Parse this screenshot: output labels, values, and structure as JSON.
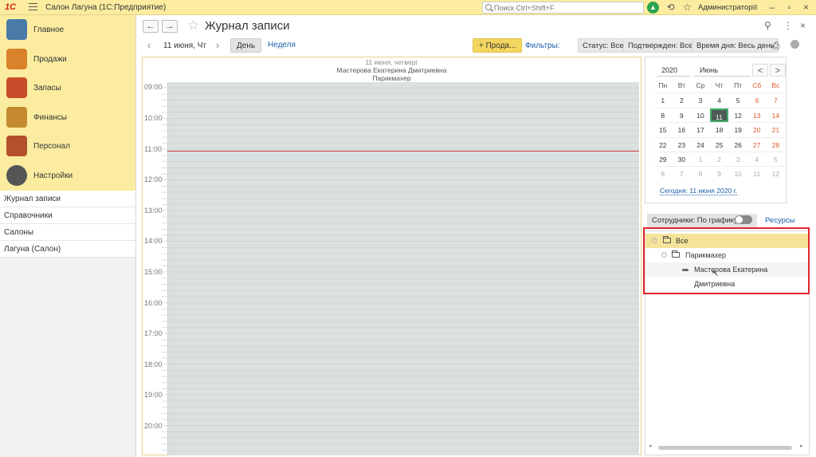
{
  "titlebar": {
    "logo": "1С",
    "app_title": "Салон Лагуна (1С:Предприятие)",
    "search_placeholder": "Поиск Ctrl+Shift+F",
    "user": "Администратор"
  },
  "sections": [
    {
      "label": "Главное",
      "color": "#4a7aa8"
    },
    {
      "label": "Продажи",
      "color": "#d9822b"
    },
    {
      "label": "Запасы",
      "color": "#c94c2a"
    },
    {
      "label": "Финансы",
      "color": "#c58a2e"
    },
    {
      "label": "Персонал",
      "color": "#b4512d"
    },
    {
      "label": "Настройки",
      "color": "#555555"
    }
  ],
  "nav_items": [
    "Журнал записи",
    "Справочники",
    "Салоны",
    "Лагуна (Салон)"
  ],
  "page": {
    "title": "Журнал записи",
    "date": "11 июня, Чт",
    "day_button": "День",
    "week_button": "Неделя",
    "sale_button": "+ Прода...",
    "filters_label": "Фильтры:",
    "chips": [
      "Статус: Все",
      "Подтвержден: Все",
      "Время дня: Весь день"
    ]
  },
  "daygrid": {
    "header_date": "11 июня, четверг",
    "employee": "Мастерова Екатерина Дмитриевна",
    "position": "Парикмахер",
    "hours": [
      "09:00",
      "10:00",
      "11:00",
      "12:00",
      "13:00",
      "14:00",
      "15:00",
      "16:00",
      "17:00",
      "18:00",
      "19:00",
      "20:00"
    ]
  },
  "minical": {
    "year": "2020",
    "month": "Июнь",
    "prev": "<",
    "next": ">",
    "weekdays": [
      "Пн",
      "Вт",
      "Ср",
      "Чт",
      "Пт",
      "Сб",
      "Вс"
    ],
    "weeks": [
      [
        "1",
        "2",
        "3",
        "4",
        "5",
        "6",
        "7"
      ],
      [
        "8",
        "9",
        "10",
        "11",
        "12",
        "13",
        "14"
      ],
      [
        "15",
        "16",
        "17",
        "18",
        "19",
        "20",
        "21"
      ],
      [
        "22",
        "23",
        "24",
        "25",
        "26",
        "27",
        "28"
      ],
      [
        "29",
        "30",
        "1",
        "2",
        "3",
        "4",
        "5"
      ],
      [
        "6",
        "7",
        "8",
        "9",
        "10",
        "11",
        "12"
      ]
    ],
    "selected": "11",
    "today_link": "Сегодня: 11 июня 2020 г."
  },
  "employees": {
    "tab_label": "Сотрудники: По графику",
    "resources_label": "Ресурсы",
    "tree": [
      {
        "label": "Все",
        "level": 0
      },
      {
        "label": "Парикмахер",
        "level": 1
      },
      {
        "label": "Мастерова Екатерина Дмитриевна",
        "level": 2
      }
    ]
  }
}
